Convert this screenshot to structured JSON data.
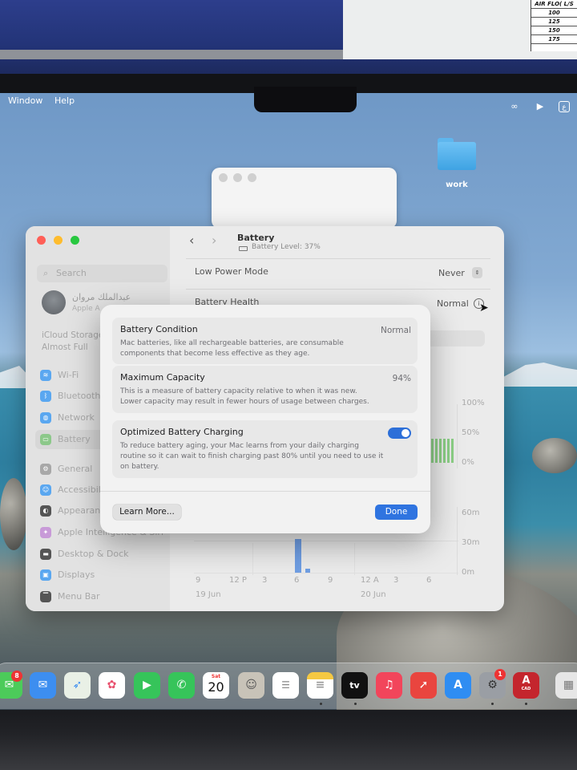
{
  "menubar": {
    "items": [
      "Window",
      "Help"
    ]
  },
  "desktop": {
    "folder_label": "work"
  },
  "paper_table": {
    "header": "AIR FLO( L/S",
    "rows": [
      "100",
      "125",
      "150",
      "175"
    ]
  },
  "settings": {
    "title": "Battery",
    "subtitle": "Battery Level: 37%",
    "search_placeholder": "Search",
    "user_name": "عبدالملك مروان",
    "user_sub": "Apple A",
    "icloud_line1": "iCloud Storage",
    "icloud_line2": "Almost Full",
    "sidebar_items": [
      "Wi-Fi",
      "Bluetooth",
      "Network",
      "Battery",
      "General",
      "Accessibili",
      "Appearanc",
      "Apple Intelligence & Siri",
      "Desktop & Dock",
      "Displays",
      "Menu Bar"
    ],
    "low_power_label": "Low Power Mode",
    "low_power_value": "Never",
    "health_label": "Battery Health",
    "health_value": "Normal",
    "y_axis_top": [
      "100%",
      "50%",
      "0%"
    ],
    "y_axis_bottom": [
      "60m",
      "30m",
      "0m"
    ],
    "x_ticks": [
      "9",
      "12 P",
      "3",
      "6",
      "9",
      "12 A",
      "3",
      "6"
    ],
    "x_dates": [
      "19 Jun",
      "20 Jun"
    ]
  },
  "sheet": {
    "condition_title": "Battery Condition",
    "condition_value": "Normal",
    "condition_desc": "Mac batteries, like all rechargeable batteries, are consumable components that become less effective as they age.",
    "capacity_title": "Maximum Capacity",
    "capacity_value": "94%",
    "capacity_desc": "This is a measure of battery capacity relative to when it was new. Lower capacity may result in fewer hours of usage between charges.",
    "optimized_title": "Optimized Battery Charging",
    "optimized_on": true,
    "optimized_desc": "To reduce battery aging, your Mac learns from your daily charging routine so it can wait to finish charging past 80% until you need to use it on battery.",
    "learn_more": "Learn More...",
    "done": "Done"
  },
  "dock": {
    "messages_badge": "8",
    "calendar_day": "Sat",
    "calendar_date": "20",
    "tv_label": "tv",
    "settings_badge": "1",
    "autocad_label": "A",
    "autocad_sub": "CAD"
  }
}
